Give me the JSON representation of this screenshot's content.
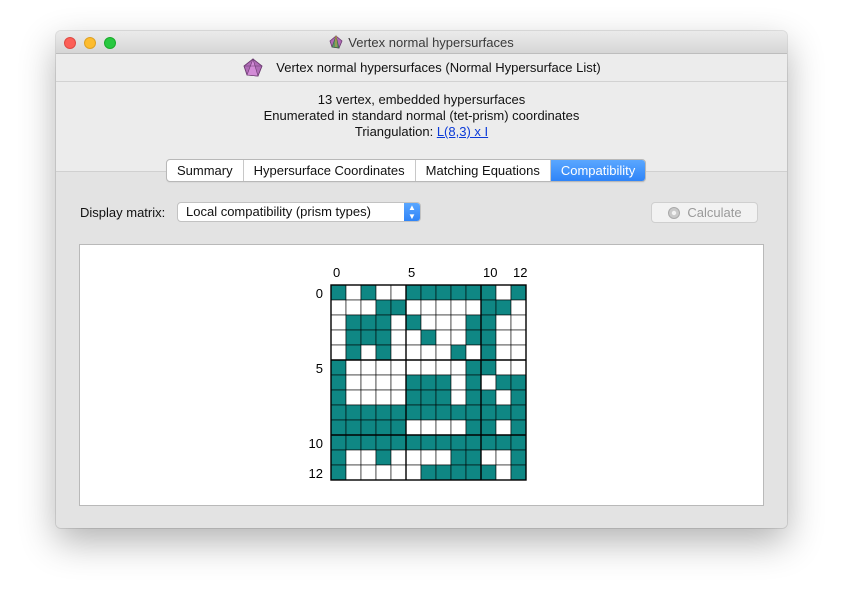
{
  "window": {
    "title": "Vertex normal hypersurfaces",
    "subtitle": "Vertex normal hypersurfaces (Normal Hypersurface List)"
  },
  "info": {
    "line1": "13 vertex, embedded hypersurfaces",
    "line2": "Enumerated in standard normal (tet-prism) coordinates",
    "triangulation_label": "Triangulation:",
    "triangulation_link": "L(8,3) x I"
  },
  "tabs": [
    {
      "label": "Summary",
      "active": false
    },
    {
      "label": "Hypersurface Coordinates",
      "active": false
    },
    {
      "label": "Matching Equations",
      "active": false
    },
    {
      "label": "Compatibility",
      "active": true
    }
  ],
  "controls": {
    "display_matrix_label": "Display matrix:",
    "display_matrix_value": "Local compatibility (prism types)",
    "calculate_label": "Calculate"
  },
  "matrix": {
    "size": 13,
    "fill_color": "#0f8784",
    "col_ticks": [
      {
        "index": 0,
        "label": "0"
      },
      {
        "index": 5,
        "label": "5"
      },
      {
        "index": 10,
        "label": "10"
      },
      {
        "index": 12,
        "label": "12"
      }
    ],
    "row_ticks": [
      {
        "index": 0,
        "label": "0"
      },
      {
        "index": 5,
        "label": "5"
      },
      {
        "index": 10,
        "label": "10"
      },
      {
        "index": 12,
        "label": "12"
      }
    ],
    "rows": [
      "1010011111101",
      "0001100000110",
      "0111010001100",
      "0111001001100",
      "0101000010100",
      "1000000001100",
      "1000011101011",
      "1000011101101",
      "1111111111111",
      "1111100001101",
      "1111111111111",
      "1001000011001",
      "1000001111101"
    ]
  }
}
